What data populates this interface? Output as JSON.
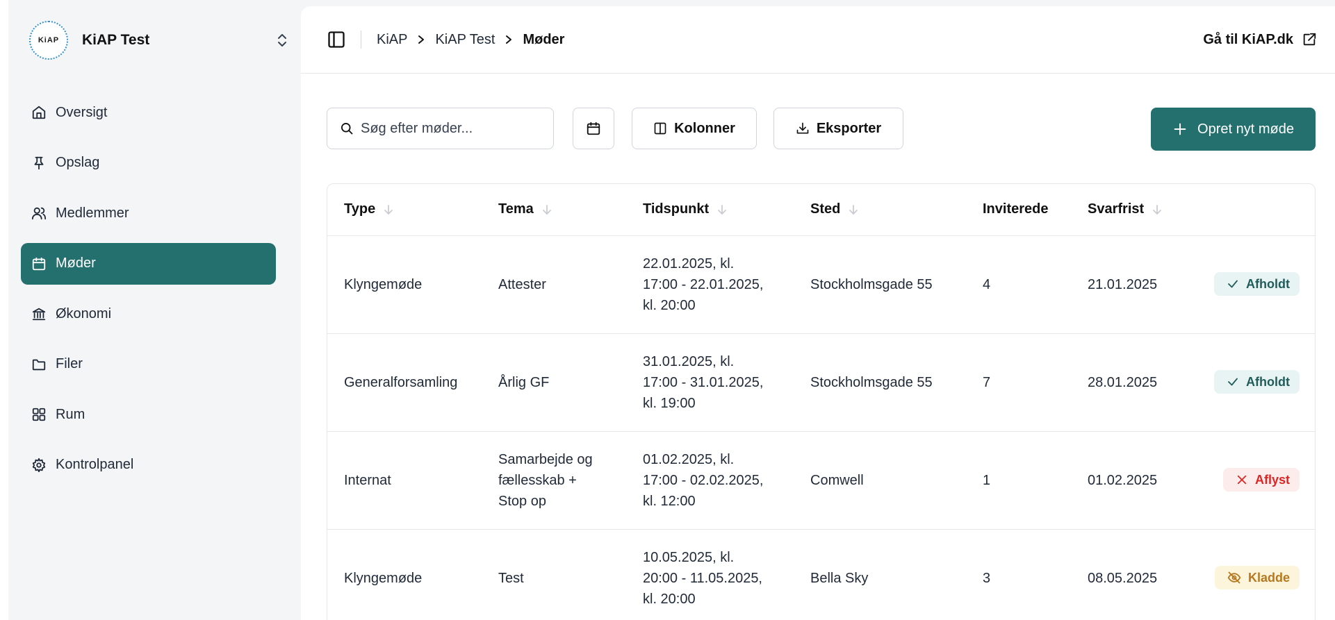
{
  "sidebar": {
    "org_logo_text": "KiAP",
    "org_name": "KiAP Test",
    "items": [
      {
        "label": "Oversigt",
        "icon": "home-icon"
      },
      {
        "label": "Opslag",
        "icon": "pin-icon"
      },
      {
        "label": "Medlemmer",
        "icon": "users-icon"
      },
      {
        "label": "Møder",
        "icon": "calendar-icon",
        "active": true
      },
      {
        "label": "Økonomi",
        "icon": "bank-icon"
      },
      {
        "label": "Filer",
        "icon": "folder-icon"
      },
      {
        "label": "Rum",
        "icon": "grid-icon"
      },
      {
        "label": "Kontrolpanel",
        "icon": "gear-icon"
      }
    ]
  },
  "header": {
    "breadcrumb": [
      "KiAP",
      "KiAP Test",
      "Møder"
    ],
    "external_link": "Gå til KiAP.dk"
  },
  "toolbar": {
    "search_placeholder": "Søg efter møder...",
    "columns_label": "Kolonner",
    "export_label": "Eksporter",
    "create_label": "Opret nyt møde"
  },
  "table": {
    "columns": [
      "Type",
      "Tema",
      "Tidspunkt",
      "Sted",
      "Inviterede",
      "Svarfrist"
    ],
    "rows": [
      {
        "type": "Klyngemøde",
        "tema": "Attester",
        "tidspunkt": [
          "22.01.2025, kl.",
          "17:00 - 22.01.2025,",
          "kl. 20:00"
        ],
        "sted": "Stockholmsgade 55",
        "inviterede": "4",
        "svarfrist": "21.01.2025",
        "status": "Afholdt",
        "status_kind": "held"
      },
      {
        "type": "Generalforsamling",
        "tema": "Årlig GF",
        "tidspunkt": [
          "31.01.2025, kl.",
          "17:00 - 31.01.2025,",
          "kl. 19:00"
        ],
        "sted": "Stockholmsgade 55",
        "inviterede": "7",
        "svarfrist": "28.01.2025",
        "status": "Afholdt",
        "status_kind": "held"
      },
      {
        "type": "Internat",
        "tema": "Samarbejde og fællesskab + Stop op",
        "tidspunkt": [
          "01.02.2025, kl.",
          "17:00 - 02.02.2025,",
          "kl. 12:00"
        ],
        "sted": "Comwell",
        "inviterede": "1",
        "svarfrist": "01.02.2025",
        "status": "Aflyst",
        "status_kind": "cancelled"
      },
      {
        "type": "Klyngemøde",
        "tema": "Test",
        "tidspunkt": [
          "10.05.2025, kl.",
          "20:00 - 11.05.2025,",
          "kl. 20:00"
        ],
        "sted": "Bella Sky",
        "inviterede": "3",
        "svarfrist": "08.05.2025",
        "status": "Kladde",
        "status_kind": "draft"
      }
    ]
  },
  "colors": {
    "accent": "#23706e",
    "held_bg": "#e8f3f3",
    "cancelled": "#dc2626",
    "draft": "#b7791f"
  }
}
